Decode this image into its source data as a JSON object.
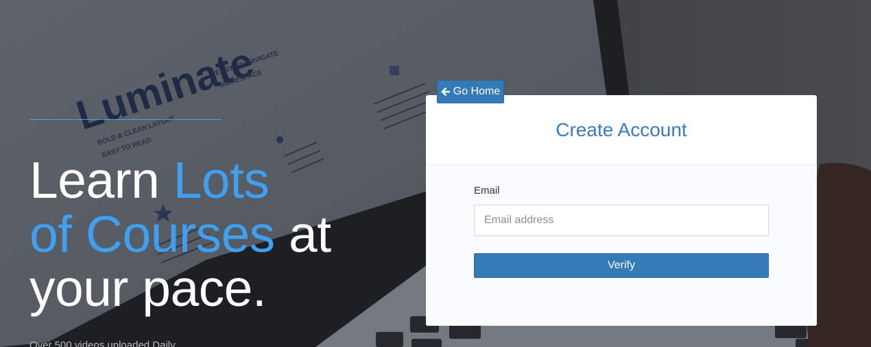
{
  "hero": {
    "title_line1_plain": "Learn ",
    "title_line1_accent": "Lots",
    "title_line2_accent": "of Courses",
    "title_line2_plain": " at",
    "title_line3_plain": "your pace.",
    "subtitle": "Over 500 videos uploaded Daily",
    "accent_color": "#3f9ff0"
  },
  "background": {
    "brand_text": "Luminate",
    "tag_1": "EASY TO NAVIGATE",
    "tag_2": "MORESPACE",
    "tag_3": "BOLD & CLEAN LAYOUT",
    "tag_4": "EASY TO READ"
  },
  "nav": {
    "go_home_label": "Go Home",
    "go_home_icon": "arrow-left-icon"
  },
  "form": {
    "title": "Create Account",
    "email_label": "Email",
    "email_placeholder": "Email address",
    "email_value": "",
    "submit_label": "Verify",
    "primary_color": "#337ab7"
  }
}
